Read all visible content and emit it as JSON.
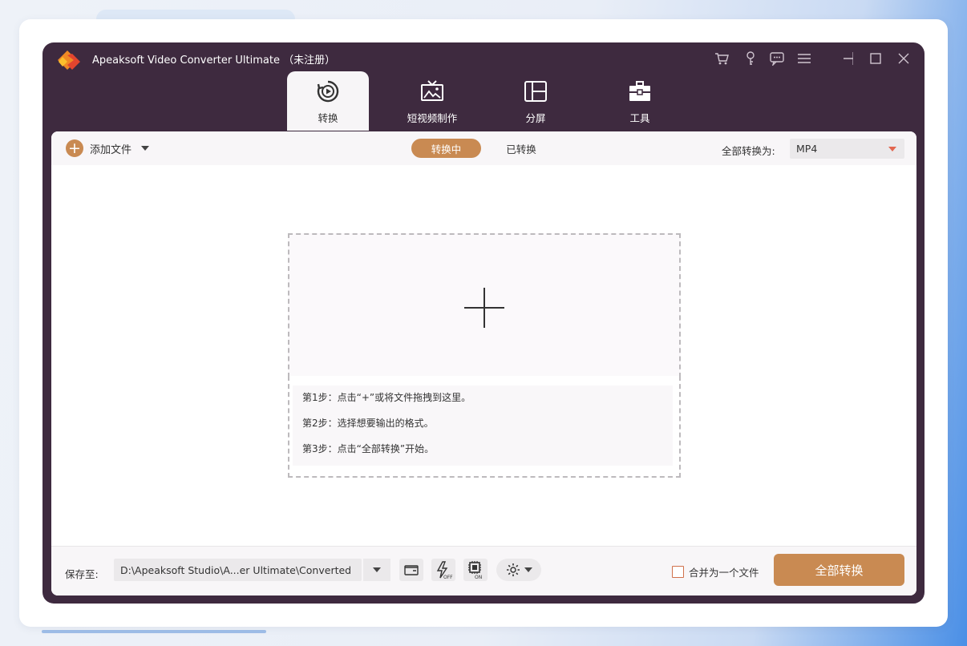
{
  "window": {
    "title": "Apeaksoft Video Converter Ultimate （未注册）"
  },
  "tabs": [
    {
      "label": "转换",
      "icon": "convert-icon",
      "active": true
    },
    {
      "label": "短视频制作",
      "icon": "tv-icon",
      "active": false
    },
    {
      "label": "分屏",
      "icon": "split-screen-icon",
      "active": false
    },
    {
      "label": "工具",
      "icon": "toolbox-icon",
      "active": false
    }
  ],
  "toolbar": {
    "add_file_label": "添加文件",
    "segments": {
      "converting": "转换中",
      "converted": "已转换"
    },
    "convert_all_to_label": "全部转换为:",
    "format_value": "MP4"
  },
  "drop_zone": {
    "steps": [
      "第1步：点击“+”或将文件拖拽到这里。",
      "第2步：选择想要输出的格式。",
      "第3步：点击“全部转换”开始。"
    ]
  },
  "bottom": {
    "save_to_label": "保存至:",
    "path_value": "D:\\Apeaksoft Studio\\A...er Ultimate\\Converted",
    "merge_label": "合并为一个文件",
    "convert_all_button": "全部转换"
  },
  "colors": {
    "accent": "#c98a52",
    "window_bg": "#3e2a3f",
    "format_arrow": "#e2664f"
  }
}
